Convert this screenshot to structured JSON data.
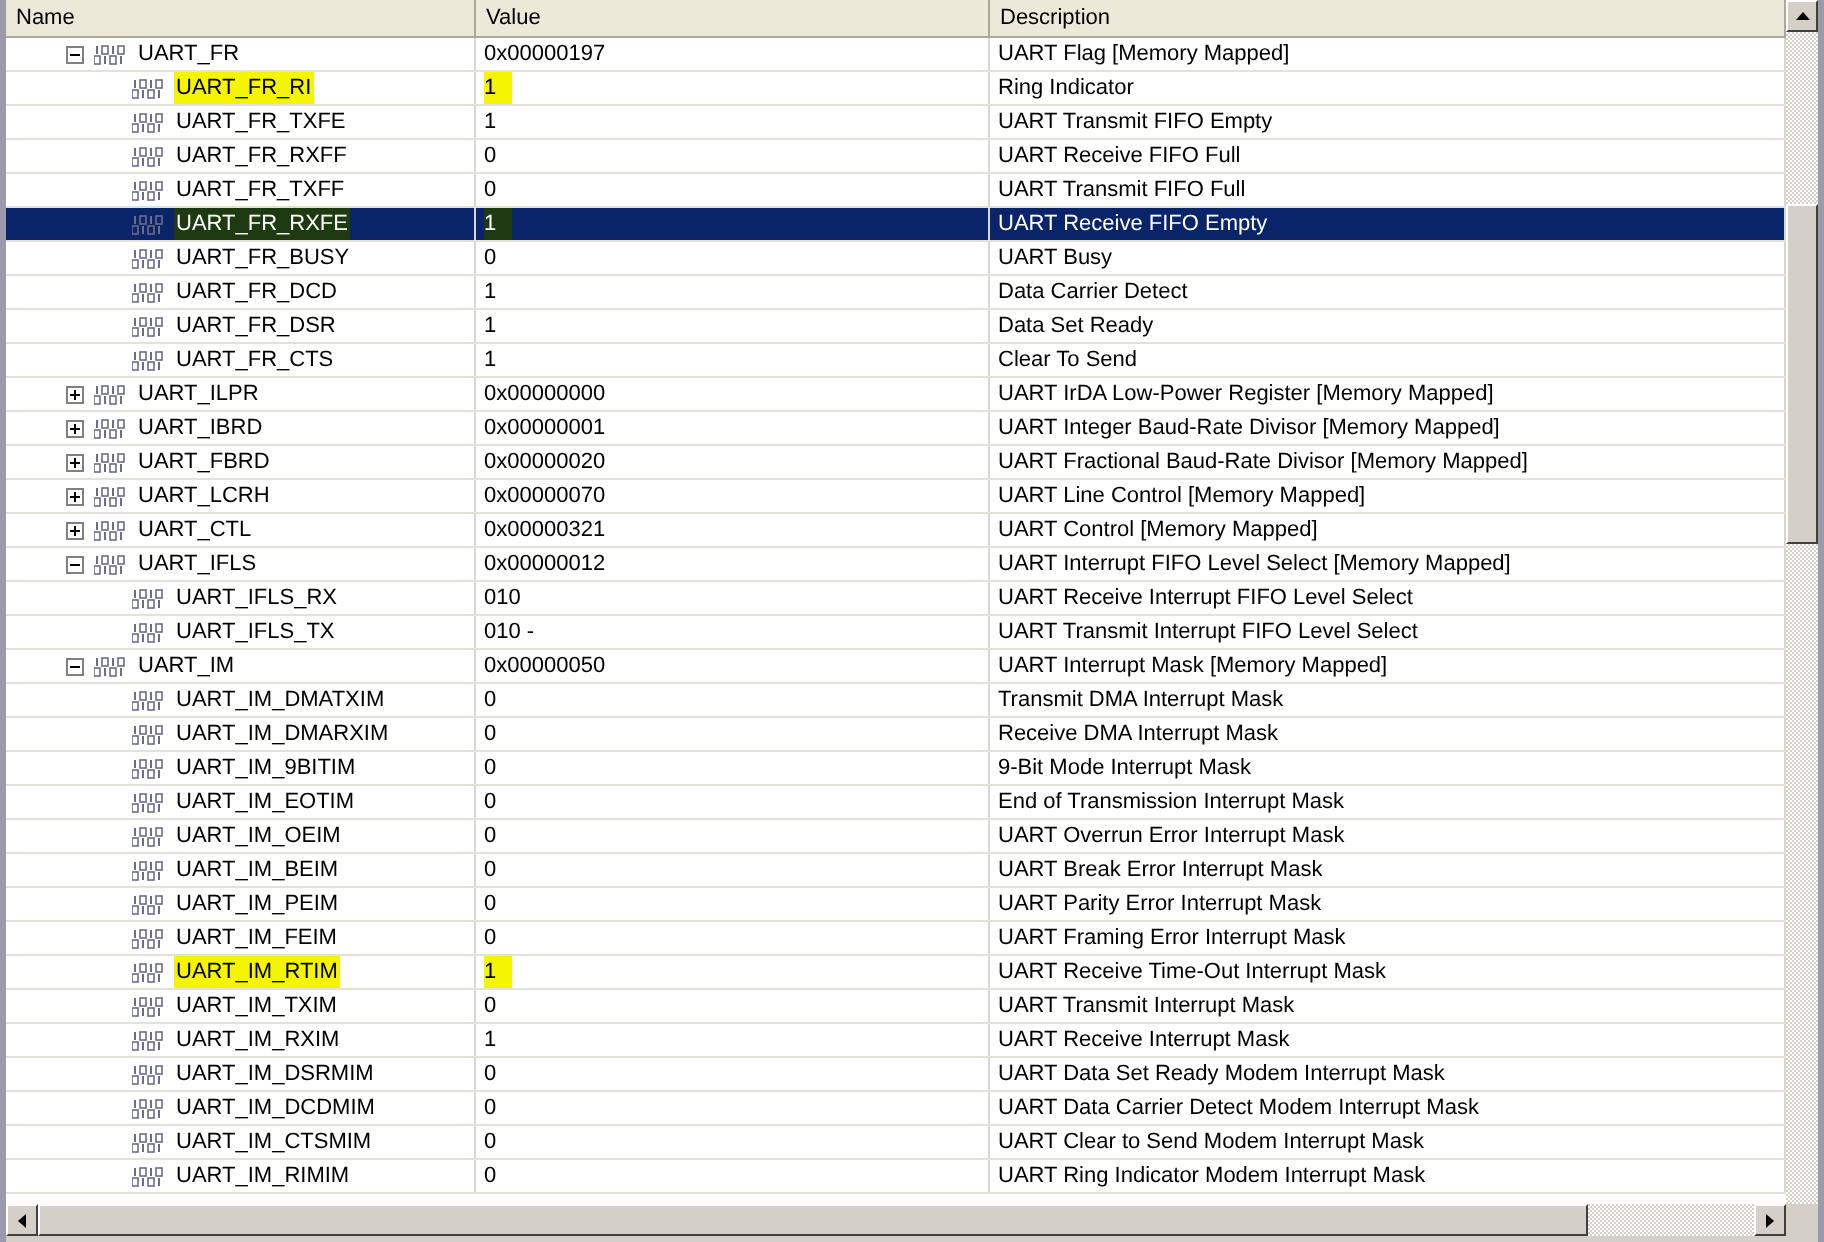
{
  "columns": [
    "Name",
    "Value",
    "Description"
  ],
  "registers": [
    {
      "name": "UART_FR",
      "value": "0x00000197",
      "description": "UART Flag [Memory Mapped]",
      "expanded": true,
      "selected": false,
      "highlighted": false,
      "children": [
        {
          "name": "UART_FR_RI",
          "value": "1",
          "description": "Ring Indicator",
          "selected": false,
          "highlighted": true
        },
        {
          "name": "UART_FR_TXFE",
          "value": "1",
          "description": "UART Transmit FIFO Empty",
          "selected": false,
          "highlighted": false
        },
        {
          "name": "UART_FR_RXFF",
          "value": "0",
          "description": "UART Receive FIFO Full",
          "selected": false,
          "highlighted": false
        },
        {
          "name": "UART_FR_TXFF",
          "value": "0",
          "description": "UART Transmit FIFO Full",
          "selected": false,
          "highlighted": false
        },
        {
          "name": "UART_FR_RXFE",
          "value": "1",
          "description": "UART Receive FIFO Empty",
          "selected": true,
          "highlighted": true
        },
        {
          "name": "UART_FR_BUSY",
          "value": "0",
          "description": "UART Busy",
          "selected": false,
          "highlighted": false
        },
        {
          "name": "UART_FR_DCD",
          "value": "1",
          "description": "Data Carrier Detect",
          "selected": false,
          "highlighted": false
        },
        {
          "name": "UART_FR_DSR",
          "value": "1",
          "description": "Data Set Ready",
          "selected": false,
          "highlighted": false
        },
        {
          "name": "UART_FR_CTS",
          "value": "1",
          "description": "Clear To Send",
          "selected": false,
          "highlighted": false
        }
      ]
    },
    {
      "name": "UART_ILPR",
      "value": "0x00000000",
      "description": "UART IrDA Low-Power Register [Memory Mapped]",
      "expanded": false,
      "selected": false,
      "highlighted": false
    },
    {
      "name": "UART_IBRD",
      "value": "0x00000001",
      "description": "UART Integer Baud-Rate Divisor [Memory Mapped]",
      "expanded": false,
      "selected": false,
      "highlighted": false
    },
    {
      "name": "UART_FBRD",
      "value": "0x00000020",
      "description": "UART Fractional Baud-Rate Divisor [Memory Mapped]",
      "expanded": false,
      "selected": false,
      "highlighted": false
    },
    {
      "name": "UART_LCRH",
      "value": "0x00000070",
      "description": "UART Line Control [Memory Mapped]",
      "expanded": false,
      "selected": false,
      "highlighted": false
    },
    {
      "name": "UART_CTL",
      "value": "0x00000321",
      "description": "UART Control [Memory Mapped]",
      "expanded": false,
      "selected": false,
      "highlighted": false
    },
    {
      "name": "UART_IFLS",
      "value": "0x00000012",
      "description": "UART Interrupt FIFO Level Select [Memory Mapped]",
      "expanded": true,
      "selected": false,
      "highlighted": false,
      "children": [
        {
          "name": "UART_IFLS_RX",
          "value": "010",
          "description": "UART Receive Interrupt FIFO Level Select",
          "selected": false,
          "highlighted": false
        },
        {
          "name": "UART_IFLS_TX",
          "value": "010 -",
          "description": "UART Transmit Interrupt FIFO Level Select",
          "selected": false,
          "highlighted": false
        }
      ]
    },
    {
      "name": "UART_IM",
      "value": "0x00000050",
      "description": "UART Interrupt Mask [Memory Mapped]",
      "expanded": true,
      "selected": false,
      "highlighted": false,
      "children": [
        {
          "name": "UART_IM_DMATXIM",
          "value": "0",
          "description": "Transmit DMA Interrupt Mask",
          "selected": false,
          "highlighted": false
        },
        {
          "name": "UART_IM_DMARXIM",
          "value": "0",
          "description": "Receive DMA Interrupt Mask",
          "selected": false,
          "highlighted": false
        },
        {
          "name": "UART_IM_9BITIM",
          "value": "0",
          "description": "9-Bit Mode Interrupt Mask",
          "selected": false,
          "highlighted": false
        },
        {
          "name": "UART_IM_EOTIM",
          "value": "0",
          "description": "End of Transmission Interrupt Mask",
          "selected": false,
          "highlighted": false
        },
        {
          "name": "UART_IM_OEIM",
          "value": "0",
          "description": "UART Overrun Error Interrupt Mask",
          "selected": false,
          "highlighted": false
        },
        {
          "name": "UART_IM_BEIM",
          "value": "0",
          "description": "UART Break Error Interrupt Mask",
          "selected": false,
          "highlighted": false
        },
        {
          "name": "UART_IM_PEIM",
          "value": "0",
          "description": "UART Parity Error Interrupt Mask",
          "selected": false,
          "highlighted": false
        },
        {
          "name": "UART_IM_FEIM",
          "value": "0",
          "description": "UART Framing Error Interrupt Mask",
          "selected": false,
          "highlighted": false
        },
        {
          "name": "UART_IM_RTIM",
          "value": "1",
          "description": "UART Receive Time-Out Interrupt Mask",
          "selected": false,
          "highlighted": true
        },
        {
          "name": "UART_IM_TXIM",
          "value": "0",
          "description": "UART Transmit Interrupt Mask",
          "selected": false,
          "highlighted": false
        },
        {
          "name": "UART_IM_RXIM",
          "value": "1",
          "description": "UART Receive Interrupt Mask",
          "selected": false,
          "highlighted": false
        },
        {
          "name": "UART_IM_DSRMIM",
          "value": "0",
          "description": "UART Data Set Ready Modem Interrupt Mask",
          "selected": false,
          "highlighted": false
        },
        {
          "name": "UART_IM_DCDMIM",
          "value": "0",
          "description": "UART Data Carrier Detect Modem Interrupt Mask",
          "selected": false,
          "highlighted": false
        },
        {
          "name": "UART_IM_CTSMIM",
          "value": "0",
          "description": "UART Clear to Send Modem Interrupt Mask",
          "selected": false,
          "highlighted": false
        },
        {
          "name": "UART_IM_RIMIM",
          "value": "0",
          "description": "UART Ring Indicator Modem Interrupt Mask",
          "selected": false,
          "highlighted": false
        }
      ]
    }
  ]
}
